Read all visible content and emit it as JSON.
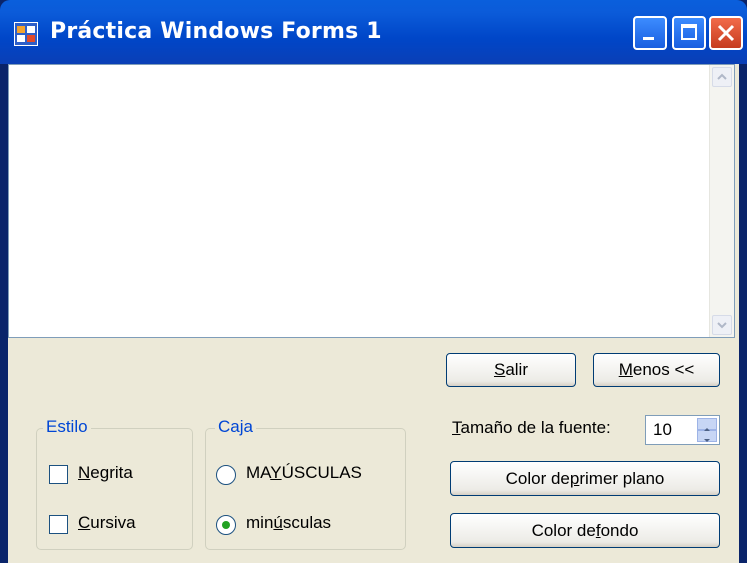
{
  "window": {
    "title": "Práctica Windows Forms 1",
    "controls": [
      "minimize-icon",
      "maximize-icon",
      "close-icon"
    ]
  },
  "textbox": {
    "value": ""
  },
  "buttons": {
    "salir": {
      "first": "S",
      "rest": "alir"
    },
    "menos": {
      "first": "M",
      "rest": "enos <<"
    },
    "color_primer": {
      "before": "Color de ",
      "u": "p",
      "after": "rimer plano"
    },
    "color_fondo": {
      "before": "Color de ",
      "u": "f",
      "after": "ondo"
    }
  },
  "estilo": {
    "title": "Estilo",
    "negrita": {
      "first": "N",
      "rest": "egrita",
      "checked": false
    },
    "cursiva": {
      "first": "C",
      "rest": "ursiva",
      "checked": false
    }
  },
  "caja": {
    "title": "Caja",
    "mayusculas": {
      "before": "MA",
      "u": "Y",
      "after": "ÚSCULAS",
      "selected": false
    },
    "minusculas": {
      "before": "min",
      "u": "ú",
      "after": "sculas",
      "selected": true
    }
  },
  "font_size": {
    "label_first": "T",
    "label_rest": "amaño de la fuente:",
    "value": "10"
  },
  "colors": {
    "accent": "#0046d5",
    "titlebar": "#0a5fdc",
    "form_bg": "#ece9d8"
  }
}
